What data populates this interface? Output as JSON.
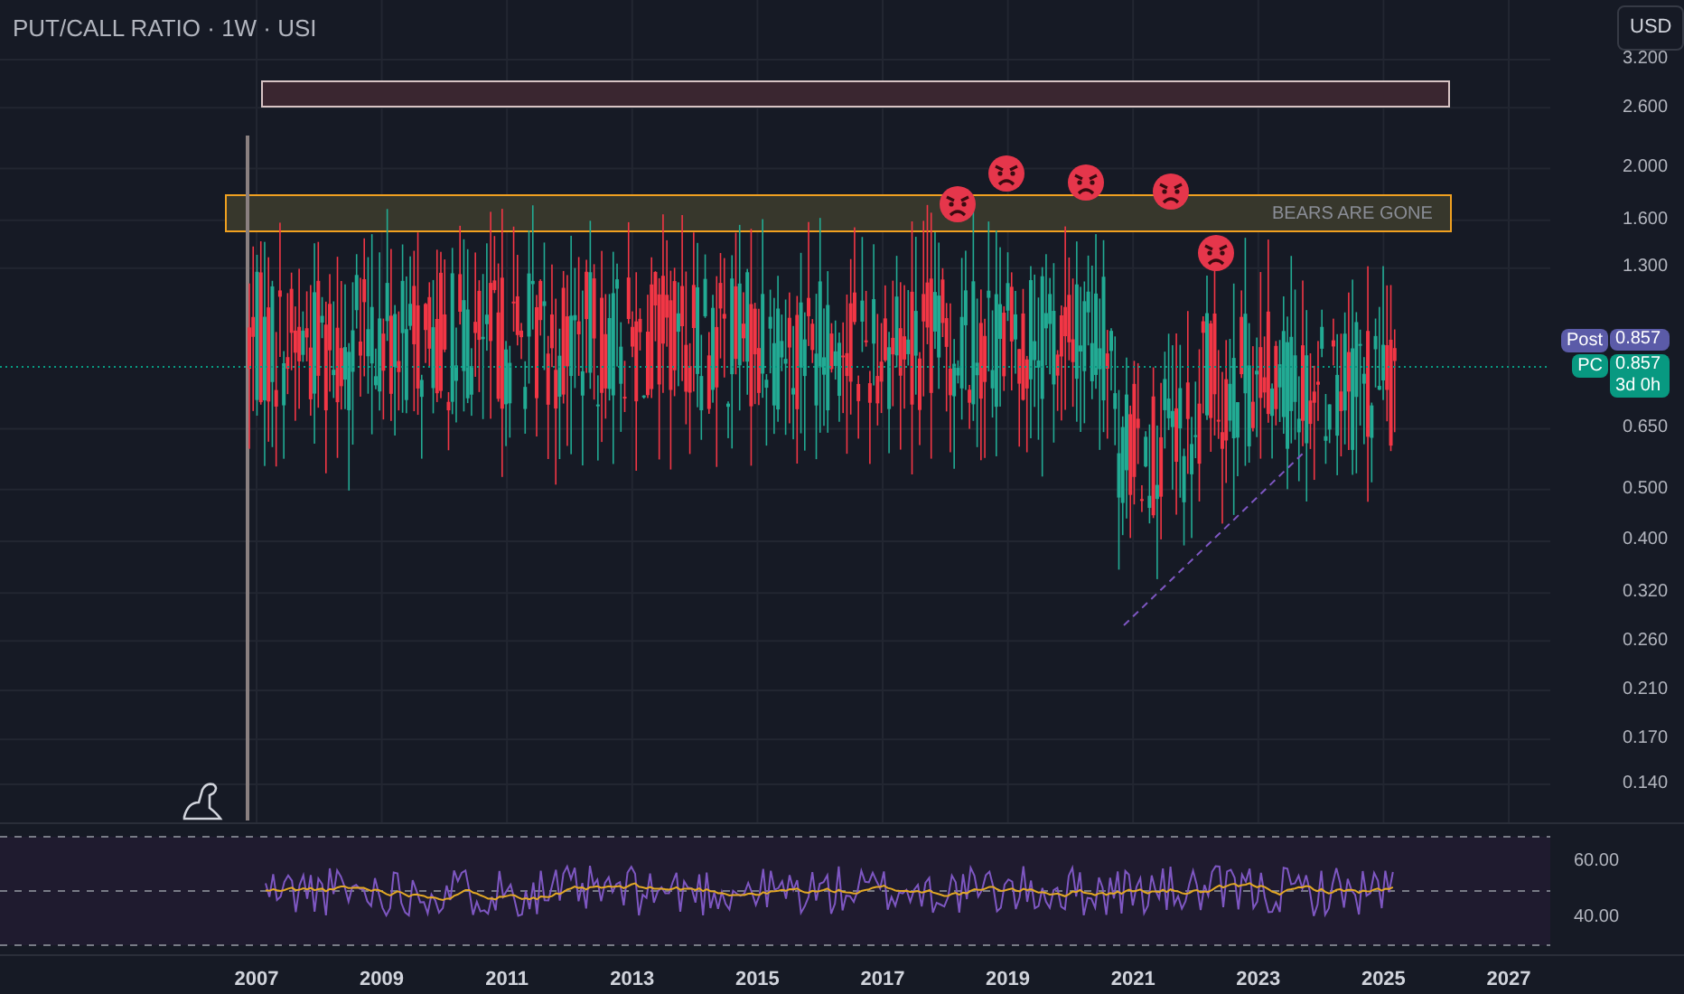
{
  "title": "PUT/CALL RATIO · 1W · USI",
  "currency_button": "USD",
  "zone_label": "BEARS ARE GONE",
  "price_axis": [
    "3.200",
    "2.600",
    "2.000",
    "1.600",
    "1.300",
    "0.650",
    "0.500",
    "0.400",
    "0.320",
    "0.260",
    "0.210",
    "0.170",
    "0.140"
  ],
  "price_tags": [
    {
      "kind": "post",
      "name": "Post",
      "value": "0.857"
    },
    {
      "kind": "symbol",
      "name": "PC",
      "value": "0.857",
      "countdown": "3d 0h"
    }
  ],
  "rsi_axis": [
    "60.00",
    "40.00"
  ],
  "time_axis": [
    "2007",
    "2009",
    "2011",
    "2013",
    "2015",
    "2017",
    "2019",
    "2021",
    "2023",
    "2025",
    "2027"
  ]
}
